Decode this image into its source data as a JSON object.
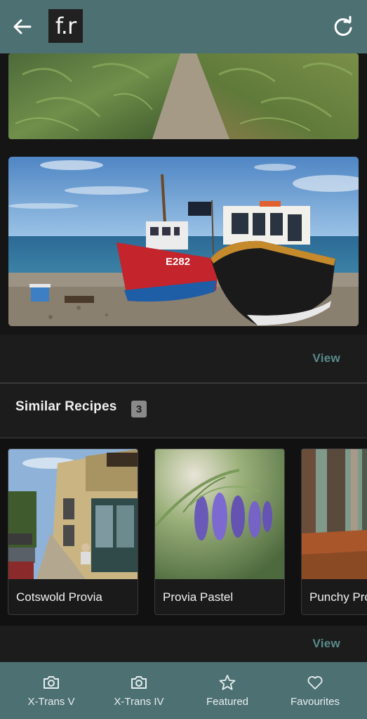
{
  "app_bar": {
    "logo_text": "f.r",
    "back_icon": "arrow-left-icon",
    "refresh_icon": "refresh-icon"
  },
  "gallery": {
    "photos": [
      {
        "subject": "path through ferns"
      },
      {
        "subject": "fishing boats on beach",
        "boat_number": "E282"
      }
    ],
    "view_label": "View"
  },
  "similar_recipes": {
    "title": "Similar Recipes",
    "count": "3",
    "items": [
      {
        "name": "Cotswold Provia"
      },
      {
        "name": "Provia Pastel"
      },
      {
        "name": "Punchy Provia"
      }
    ],
    "view_label": "View"
  },
  "bottom_nav": {
    "items": [
      {
        "label": "X-Trans V",
        "icon": "camera-icon"
      },
      {
        "label": "X-Trans IV",
        "icon": "camera-icon"
      },
      {
        "label": "Featured",
        "icon": "star-icon"
      },
      {
        "label": "Favourites",
        "icon": "heart-icon"
      }
    ]
  },
  "colors": {
    "accent": "#4d7073",
    "link": "#5a8a8c",
    "background": "#151515"
  }
}
